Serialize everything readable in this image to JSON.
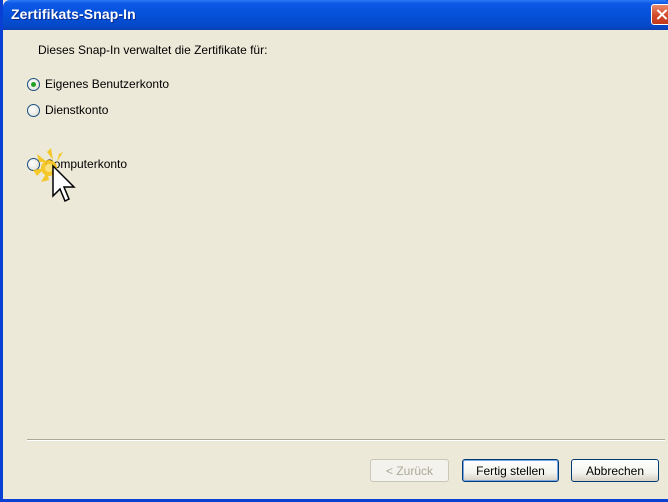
{
  "window": {
    "title": "Zertifikats-Snap-In"
  },
  "form": {
    "intro": "Dieses Snap-In verwaltet die Zertifikate für:",
    "options": [
      {
        "label": "Eigenes Benutzerkonto",
        "selected": true
      },
      {
        "label": "Dienstkonto",
        "selected": false
      },
      {
        "label": "Computerkonto",
        "selected": false
      }
    ]
  },
  "buttons": {
    "back": "< Zurück",
    "finish": "Fertig stellen",
    "cancel": "Abbrechen"
  },
  "colors": {
    "titlebar": "#0551d9",
    "dialog_bg": "#ece9d8",
    "radio_dot": "#21a121"
  }
}
